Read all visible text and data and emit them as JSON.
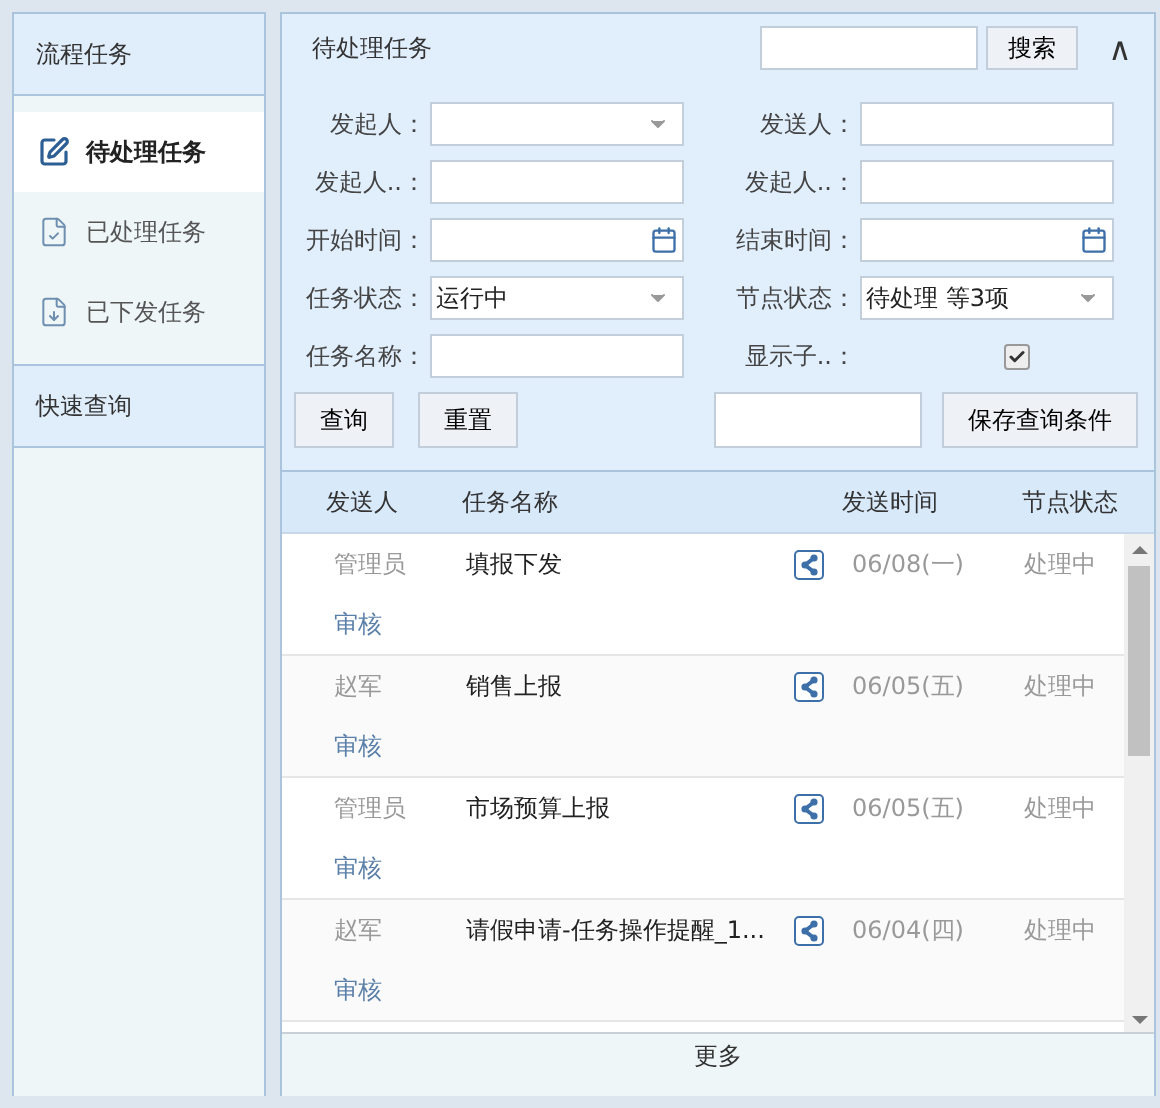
{
  "sidebar": {
    "sections": [
      {
        "title": "流程任务",
        "items": [
          {
            "label": "待处理任务",
            "kind": "edit",
            "selected": true
          },
          {
            "label": "已处理任务",
            "kind": "check",
            "selected": false
          },
          {
            "label": "已下发任务",
            "kind": "send",
            "selected": false
          }
        ]
      },
      {
        "title": "快速查询"
      }
    ]
  },
  "panel": {
    "title": "待处理任务",
    "search_button": "搜索",
    "collapse": "∧"
  },
  "filters": [
    {
      "label": "发起人：",
      "kind": "select"
    },
    {
      "label": "发送人：",
      "kind": "text"
    },
    {
      "label": "发起人..：",
      "kind": "text"
    },
    {
      "label": "发起人..：",
      "kind": "text"
    },
    {
      "label": "开始时间：",
      "kind": "date"
    },
    {
      "label": "结束时间：",
      "kind": "date"
    },
    {
      "label": "任务状态：",
      "kind": "select",
      "value": "运行中"
    },
    {
      "label": "节点状态：",
      "kind": "select",
      "value": "待处理 等3项"
    },
    {
      "label": "任务名称：",
      "kind": "text"
    },
    {
      "label": "显示子..：",
      "kind": "checkbox",
      "checked": true
    }
  ],
  "actions": {
    "query": "查询",
    "reset": "重置",
    "save": "保存查询条件"
  },
  "table": {
    "columns": [
      "发送人",
      "任务名称",
      "发送时间",
      "节点状态"
    ],
    "rows": [
      {
        "sender": "管理员",
        "name": "填报下发",
        "time": "06/08(一)",
        "status": "处理中",
        "node": "审核"
      },
      {
        "sender": "赵军",
        "name": "销售上报",
        "time": "06/05(五)",
        "status": "处理中",
        "node": "审核"
      },
      {
        "sender": "管理员",
        "name": "市场预算上报",
        "time": "06/05(五)",
        "status": "处理中",
        "node": "审核"
      },
      {
        "sender": "赵军",
        "name": "请假申请-任务操作提醒_1...",
        "time": "06/04(四)",
        "status": "处理中",
        "node": "审核"
      }
    ]
  },
  "more": "更多"
}
